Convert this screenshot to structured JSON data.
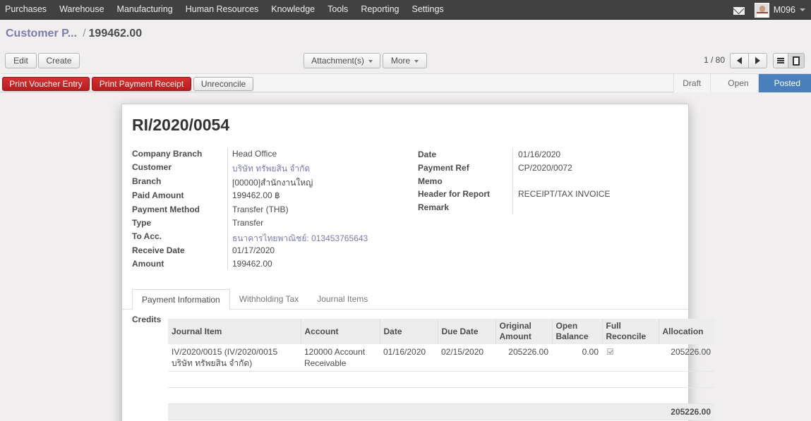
{
  "topmenu": [
    "Purchases",
    "Warehouse",
    "Manufacturing",
    "Human Resources",
    "Knowledge",
    "Tools",
    "Reporting",
    "Settings"
  ],
  "user": "M096",
  "breadcrumb": {
    "parent": "Customer P...",
    "separator": "/",
    "current": "199462.00"
  },
  "toolbar": {
    "edit": "Edit",
    "create": "Create",
    "attachments": "Attachment(s)",
    "more": "More"
  },
  "pager": {
    "text": "1 / 80"
  },
  "actions": {
    "print_voucher": "Print Voucher Entry",
    "print_receipt": "Print Payment Receipt",
    "unreconcile": "Unreconcile"
  },
  "stages": [
    "Draft",
    "Open",
    "Posted"
  ],
  "active_stage": "Posted",
  "colors": {
    "accent": "#7c7bad",
    "stage_active": "#4a7fbd",
    "danger": "#c9282a"
  },
  "record": {
    "title": "RI/2020/0054",
    "left": [
      {
        "label": "Company Branch",
        "value": "Head Office"
      },
      {
        "label": "Customer",
        "value": "บริษัท ทรัพยสิน จำกัด"
      },
      {
        "label": "Branch",
        "value": "[00000]สำนักงานใหญ่"
      },
      {
        "label": "Paid Amount",
        "value": "199462.00 ฿"
      },
      {
        "label": "Payment Method",
        "value": "Transfer (THB)"
      },
      {
        "label": "Type",
        "value": "Transfer"
      },
      {
        "label": "To Acc.",
        "value": "ธนาคารไทยพาณิชย์: 013453765643"
      },
      {
        "label": "Receive Date",
        "value": "01/17/2020"
      },
      {
        "label": "Amount",
        "value": "199462.00"
      }
    ],
    "right": [
      {
        "label": "Date",
        "value": "01/16/2020"
      },
      {
        "label": "Payment Ref",
        "value": "CP/2020/0072"
      },
      {
        "label": "Memo",
        "value": ""
      },
      {
        "label": "Header for Report",
        "value": "RECEIPT/TAX INVOICE"
      },
      {
        "label": "Remark",
        "value": ""
      }
    ]
  },
  "tabs": [
    "Payment Information",
    "Withholding Tax",
    "Journal Items"
  ],
  "credits": {
    "label": "Credits",
    "columns": [
      "Journal Item",
      "Account",
      "Date",
      "Due Date",
      "Original Amount",
      "Open Balance",
      "Full Reconcile",
      "Allocation"
    ],
    "rows": [
      {
        "journal_item": "IV/2020/0015 (IV/2020/0015 บริษัท ทรัพยสิน จำกัด)",
        "account": "120000 Account Receivable",
        "date": "01/16/2020",
        "due_date": "02/15/2020",
        "original_amount": "205226.00",
        "open_balance": "0.00",
        "full_reconcile": true,
        "allocation": "205226.00"
      }
    ],
    "total_allocation": "205226.00"
  }
}
